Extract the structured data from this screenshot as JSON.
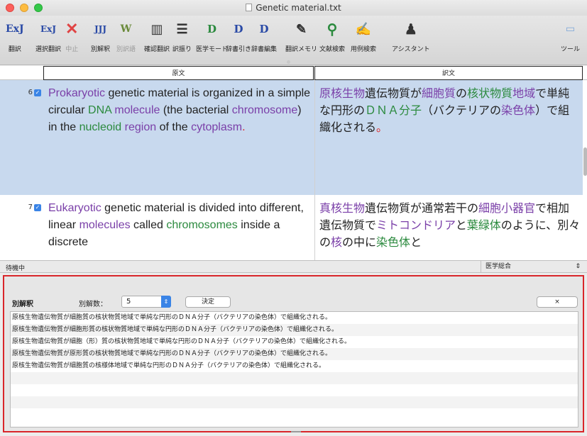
{
  "window": {
    "title": "Genetic material.txt"
  },
  "toolbar": {
    "items": [
      {
        "icon": "ExJ",
        "label": "翻訳",
        "name": "translate"
      },
      {
        "icon": "ExJ",
        "label": "選択翻訳",
        "name": "selection-translate"
      },
      {
        "icon": "✕",
        "label": "中止",
        "name": "stop"
      },
      {
        "icon": "JJJ",
        "label": "別解釈",
        "name": "alternate-interpretation"
      },
      {
        "icon": "W",
        "label": "別訳語",
        "name": "alternate-term"
      },
      {
        "icon": "▥",
        "label": "確認翻訳",
        "name": "confirm-translate"
      },
      {
        "icon": "☰",
        "label": "訳振り",
        "name": "interlinear"
      },
      {
        "icon": "D",
        "label": "医学モード",
        "name": "medical-mode"
      },
      {
        "icon": "D",
        "label": "辞書引き",
        "name": "dictionary-lookup"
      },
      {
        "icon": "D",
        "label": "辞書編集",
        "name": "dictionary-edit"
      },
      {
        "icon": "✎",
        "label": "翻訳メモリ",
        "name": "translation-memory"
      },
      {
        "icon": "⚲",
        "label": "文献検索",
        "name": "literature-search"
      },
      {
        "icon": "✍",
        "label": "用例検索",
        "name": "example-search"
      },
      {
        "icon": "♟",
        "label": "アシスタント",
        "name": "assistant"
      },
      {
        "icon": "▭",
        "label": "ツール",
        "name": "tools"
      }
    ]
  },
  "columns": {
    "source": "原文",
    "target": "訳文"
  },
  "segments": [
    {
      "number": "6",
      "source_parts": [
        {
          "text": "Prokaryotic",
          "c": "t"
        },
        {
          "text": " genetic material is organized in a simple circular ",
          "c": ""
        },
        {
          "text": "DNA",
          "c": "g"
        },
        {
          "text": " ",
          "c": ""
        },
        {
          "text": "molecule",
          "c": "t"
        },
        {
          "text": " (the bacterial ",
          "c": ""
        },
        {
          "text": "chromosome",
          "c": "t"
        },
        {
          "text": ") in the ",
          "c": ""
        },
        {
          "text": "nucleoid",
          "c": "g"
        },
        {
          "text": " ",
          "c": ""
        },
        {
          "text": "region",
          "c": "t"
        },
        {
          "text": " of the ",
          "c": ""
        },
        {
          "text": "cytoplasm",
          "c": "t"
        },
        {
          "text": ".",
          "c": "r"
        }
      ],
      "target_parts": [
        {
          "text": "原核生物",
          "c": "t"
        },
        {
          "text": "遺伝物質が",
          "c": ""
        },
        {
          "text": "細胞質",
          "c": "t"
        },
        {
          "text": "の",
          "c": ""
        },
        {
          "text": "核状物質",
          "c": "g"
        },
        {
          "text": "地域",
          "c": "t"
        },
        {
          "text": "で単純な円形の",
          "c": ""
        },
        {
          "text": "ＤＮＡ分子",
          "c": "g"
        },
        {
          "text": "（バクテリアの",
          "c": ""
        },
        {
          "text": "染色体",
          "c": "t"
        },
        {
          "text": "）で組織化される",
          "c": ""
        },
        {
          "text": "。",
          "c": "r"
        }
      ]
    },
    {
      "number": "7",
      "source_parts": [
        {
          "text": "Eukaryotic",
          "c": "t"
        },
        {
          "text": " genetic material is divided into different, linear ",
          "c": ""
        },
        {
          "text": "molecules",
          "c": "t"
        },
        {
          "text": " called ",
          "c": ""
        },
        {
          "text": "chromosomes",
          "c": "g"
        },
        {
          "text": " inside a discrete",
          "c": ""
        }
      ],
      "target_parts": [
        {
          "text": "真核生物",
          "c": "t"
        },
        {
          "text": "遺伝物質が通常若干の",
          "c": ""
        },
        {
          "text": "細胞小器官",
          "c": "t"
        },
        {
          "text": "で相加遺伝物質で",
          "c": ""
        },
        {
          "text": "ミトコンドリア",
          "c": "t"
        },
        {
          "text": "と",
          "c": ""
        },
        {
          "text": "葉緑体",
          "c": "g"
        },
        {
          "text": "のように、別々の",
          "c": ""
        },
        {
          "text": "核",
          "c": "t"
        },
        {
          "text": "の中に",
          "c": ""
        },
        {
          "text": "染色体",
          "c": "g"
        },
        {
          "text": "と",
          "c": ""
        }
      ]
    }
  ],
  "status": {
    "text": "待機中",
    "dictionary": "医学総合"
  },
  "alt_panel": {
    "title": "別解釈",
    "count_label": "別解数：",
    "count_value": "5",
    "decide_label": "決定",
    "close_label": "×",
    "items": [
      "原核生物遺伝物質が細胞質の核状物質地域で単純な円形のＤＮＡ分子（バクテリアの染色体）で組織化される。",
      "原核生物遺伝物質が細胞形質の核状物質地域で単純な円形のＤＮＡ分子（バクテリアの染色体）で組織化される。",
      "原核生物遺伝物質が細胞（形）質の核状物質地域で単純な円形のＤＮＡ分子（バクテリアの染色体）で組織化される。",
      "原核生物遺伝物質が原形質の核状物質地域で単純な円形のＤＮＡ分子（バクテリアの染色体）で組織化される。",
      "原核生物遺伝物質が細胞質の核様体地域で単純な円形のＤＮＡ分子（バクテリアの染色体）で組織化される。"
    ]
  },
  "colors": {
    "term": "#7a3fa8",
    "known": "#2b8a3e",
    "highlight_row": "#c8d9ee",
    "panel_border": "#d9262a"
  }
}
